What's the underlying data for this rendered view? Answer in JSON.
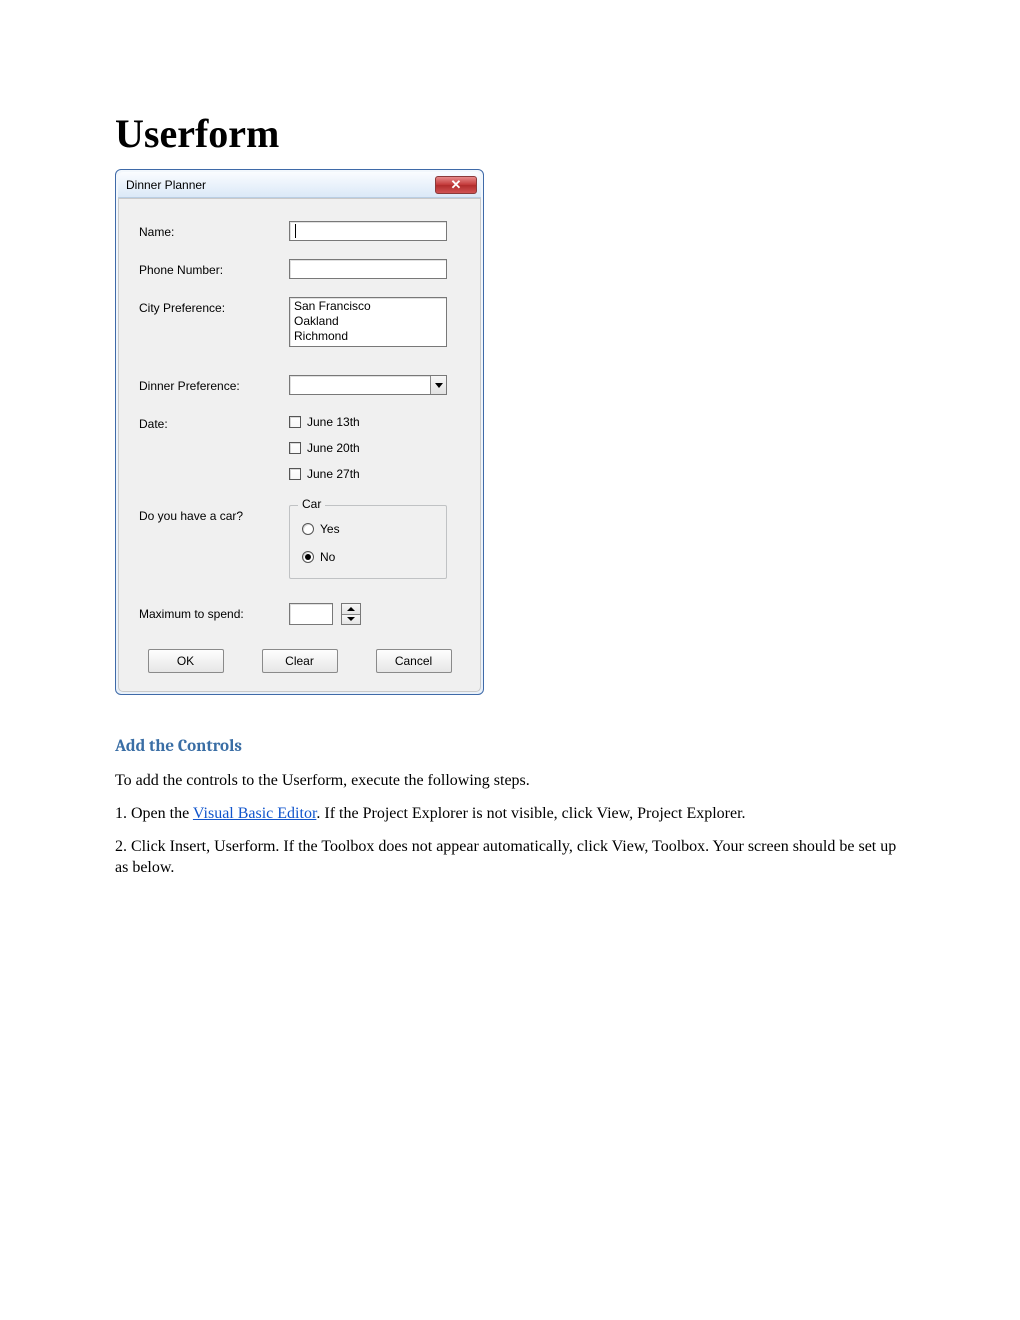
{
  "page": {
    "title": "Userform"
  },
  "dialog": {
    "title": "Dinner Planner",
    "labels": {
      "name": "Name:",
      "phone": "Phone Number:",
      "city": "City Preference:",
      "dinner": "Dinner Preference:",
      "date": "Date:",
      "car_q": "Do you have a car?",
      "max": "Maximum to spend:"
    },
    "city_options": [
      "San Francisco",
      "Oakland",
      "Richmond"
    ],
    "date_options": [
      "June 13th",
      "June 20th",
      "June 27th"
    ],
    "car_group": {
      "legend": "Car",
      "yes": "Yes",
      "no": "No",
      "selected": "no"
    },
    "buttons": {
      "ok": "OK",
      "clear": "Clear",
      "cancel": "Cancel"
    }
  },
  "article": {
    "heading": "Add the Controls",
    "intro": "To add the controls to the Userform, execute the following steps.",
    "step1_a": "1. Open the ",
    "step1_link": "Visual Basic Editor",
    "step1_b": ". If the Project Explorer is not visible, click View, Project Explorer.",
    "step2": "2. Click Insert, Userform. If the Toolbox does not appear automatically, click View, Toolbox. Your screen should be set up as below."
  }
}
